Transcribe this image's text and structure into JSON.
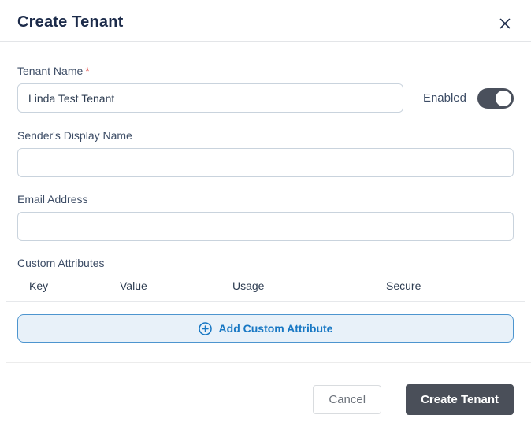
{
  "modal": {
    "title": "Create Tenant"
  },
  "form": {
    "tenant_name": {
      "label": "Tenant Name",
      "required_marker": "*",
      "value": "Linda Test Tenant"
    },
    "enabled_toggle": {
      "label": "Enabled",
      "state": "on"
    },
    "sender_display_name": {
      "label": "Sender's Display Name",
      "value": ""
    },
    "email_address": {
      "label": "Email Address",
      "value": ""
    },
    "custom_attributes": {
      "label": "Custom Attributes",
      "columns": [
        "Key",
        "Value",
        "Usage",
        "Secure"
      ],
      "rows": [],
      "add_button_label": "Add Custom Attribute"
    }
  },
  "footer": {
    "cancel_label": "Cancel",
    "submit_label": "Create Tenant"
  },
  "colors": {
    "title_text": "#1c2b4a",
    "label_text": "#3d4d66",
    "required_marker": "#e25650",
    "accent_blue": "#1878c4",
    "add_button_bg": "#e8f1f9",
    "add_button_border": "#4d95cf",
    "dark_button": "#4a4f59",
    "toggle_on": "#4a505c",
    "input_border": "#c9d3dd",
    "divider": "#e6e8eb"
  }
}
